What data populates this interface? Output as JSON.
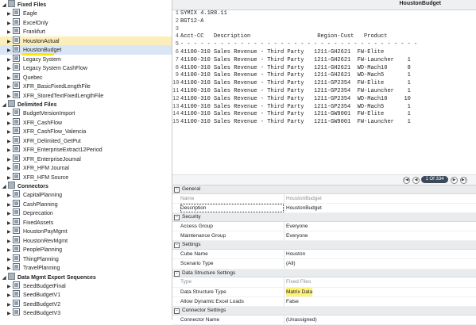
{
  "tree": {
    "groups": [
      {
        "label": "Fixed Files",
        "items": [
          "Eagle",
          "ExcelOnly",
          "Frankfurt",
          "HoustonActual",
          "HoustonBudget",
          "Legacy System",
          "Legacy System CashFlow",
          "Quebec",
          "XFR_BasicFixedLengthFile",
          "XFR_StoredTextFixedLengthFile"
        ]
      },
      {
        "label": "Delimited Files",
        "items": [
          "BudgetVersionImport",
          "XFR_CashFlow",
          "XFR_CashFlow_Valencia",
          "XFR_Delimited_GetPut",
          "XFR_EnterpriseExtract12Period",
          "XFR_EnterpriseJournal",
          "XFR_HFM Journal",
          "XFR_HFM Source"
        ]
      },
      {
        "label": "Connectors",
        "items": [
          "CapitalPlanning",
          "CashPlanning",
          "Deprecation",
          "FixedAssets",
          "HoustonPayMgmt",
          "HoustonRevMgmt",
          "PeoplePlanning",
          "ThingPlanning",
          "TravelPlanning"
        ]
      },
      {
        "label": "Data Mgmt Export Sequences",
        "items": [
          "SeedBudgetFinal",
          "SeedBudgetV1",
          "SeedBudgetV2",
          "SeedBudgetV3"
        ]
      }
    ]
  },
  "header": {
    "title": "HoustonBudget"
  },
  "code": {
    "lines": [
      {
        "n": "1",
        "t": "SYMIX 4.1R8.11"
      },
      {
        "n": "2",
        "t": "BGT12-A"
      },
      {
        "n": "3",
        "t": ""
      },
      {
        "n": "4",
        "t": "Acct-CC   Description                    Region-Cust   Product"
      },
      {
        "n": "5",
        "t": "- - - - - - - - - - - - - - - - - - - - - - - - - - - - - - - - - - - -"
      },
      {
        "n": "6",
        "t": "41100-310 Sales Revenue - Third Party   1211-GH2621  FW-Elite"
      },
      {
        "n": "7",
        "t": "41100-310 Sales Revenue - Third Party   1211-GH2621  FW-Launcher    1"
      },
      {
        "n": "8",
        "t": "41100-310 Sales Revenue - Third Party   1211-GH2621  WD-Mach10      8"
      },
      {
        "n": "9",
        "t": "41100-310 Sales Revenue - Third Party   1211-GH2621  WD-Mach5       1"
      },
      {
        "n": "10",
        "t": "41100-310 Sales Revenue - Third Party   1211-GP2354  FW-Elite       1"
      },
      {
        "n": "11",
        "t": "41100-310 Sales Revenue - Third Party   1211-GP2354  FW-Launcher    1"
      },
      {
        "n": "12",
        "t": "41100-310 Sales Revenue - Third Party   1211-GP2354  WD-Mach10     10"
      },
      {
        "n": "13",
        "t": "41100-310 Sales Revenue - Third Party   1211-GP2354  WD-Mach5       1"
      },
      {
        "n": "14",
        "t": "41100-310 Sales Revenue - Third Party   1211-GW9001  FW-Elite       1"
      },
      {
        "n": "15",
        "t": "41100-310 Sales Revenue - Third Party   1211-GW9001  FW-Launcher    1"
      }
    ]
  },
  "pager": {
    "count": "1 Of 334"
  },
  "props": {
    "sections": [
      {
        "label": "General",
        "rows": [
          {
            "k": "Name",
            "v": "HoustonBudget",
            "dim": true
          },
          {
            "k": "Description",
            "v": "HoustonBudget",
            "dim": false
          }
        ]
      },
      {
        "label": "Security",
        "rows": [
          {
            "k": "Access Group",
            "v": "Everyone",
            "dim": false
          },
          {
            "k": "Maintenance Group",
            "v": "Everyone",
            "dim": false
          }
        ]
      },
      {
        "label": "Settings",
        "rows": [
          {
            "k": "Cube Name",
            "v": "Houston",
            "dim": false
          },
          {
            "k": "Scenario Type",
            "v": "(All)",
            "dim": false
          }
        ]
      },
      {
        "label": "Data Structure Settings",
        "rows": [
          {
            "k": "Type",
            "v": "Fixed Files",
            "dim": true
          },
          {
            "k": "Data Structure Type",
            "v": "Matrix Data",
            "dim": false
          },
          {
            "k": "Allow Dynamic Excel Loads",
            "v": "False",
            "dim": false
          }
        ]
      },
      {
        "label": "Connector Settings",
        "rows": [
          {
            "k": "Connector Name",
            "v": "(Unassigned)",
            "dim": false
          }
        ]
      }
    ]
  },
  "colors": {
    "selected_bg": "#fbeeb8",
    "highlight": "#fff27a",
    "pager_bg": "#3b4a5a"
  }
}
